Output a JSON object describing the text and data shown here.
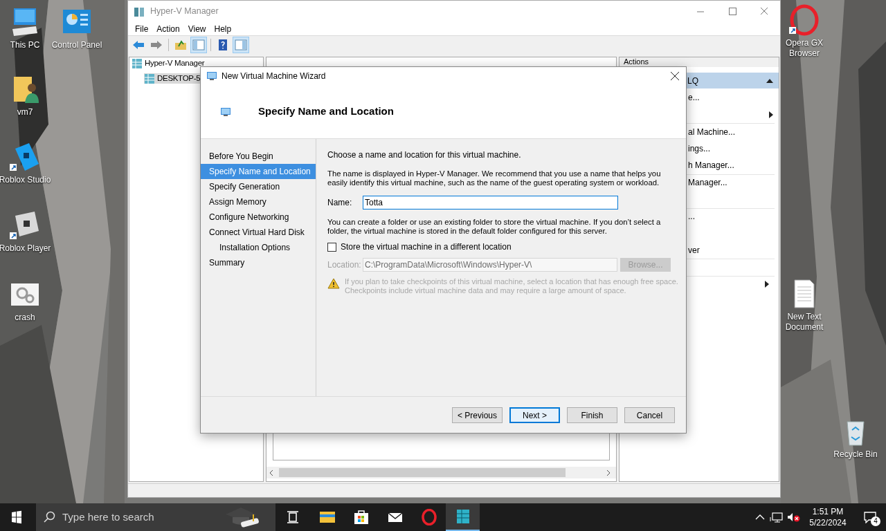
{
  "desktop_icons": [
    {
      "label": "This PC",
      "kind": "pc",
      "shortcut": false
    },
    {
      "label": "Control Panel",
      "kind": "control",
      "shortcut": false
    },
    {
      "label": "vm7",
      "kind": "folder",
      "shortcut": false
    },
    {
      "label": "Roblox Studio",
      "kind": "studio",
      "shortcut": true
    },
    {
      "label": "Roblox Player",
      "kind": "player",
      "shortcut": true
    },
    {
      "label": "crash",
      "kind": "gears",
      "shortcut": false
    },
    {
      "label": "Opera GX Browser",
      "kind": "opera",
      "shortcut": true
    },
    {
      "label": "New Text Document",
      "kind": "text",
      "shortcut": false
    },
    {
      "label": "Recycle Bin",
      "kind": "bin",
      "shortcut": false
    }
  ],
  "window": {
    "title": "Hyper-V Manager",
    "active": false,
    "menu": [
      "File",
      "Action",
      "View",
      "Help"
    ],
    "toolbar": [
      {
        "kind": "back",
        "pressed": false
      },
      {
        "kind": "forward",
        "pressed": false
      },
      {
        "kind": "up",
        "pressed": false
      },
      {
        "kind": "tree",
        "pressed": true
      },
      {
        "kind": "help",
        "pressed": false
      },
      {
        "kind": "actions",
        "pressed": true
      }
    ],
    "tree": [
      {
        "label": "Hyper-V Manager",
        "selected": false,
        "children": [
          {
            "label": "DESKTOP-5",
            "selected": true
          }
        ]
      }
    ],
    "actions": {
      "header": "Actions",
      "group": {
        "label": "LQ",
        "expanded": true
      },
      "items": [
        {
          "kind": "text",
          "label": "e..."
        },
        {
          "kind": "submenu"
        },
        {
          "kind": "text",
          "label": "al Machine..."
        },
        {
          "kind": "text",
          "label": "ings..."
        },
        {
          "kind": "text",
          "label": "h Manager..."
        },
        {
          "kind": "text",
          "label": "Manager..."
        },
        {
          "kind": "text",
          "label": "..."
        },
        {
          "kind": "text",
          "label": "ver"
        },
        {
          "kind": "submenu"
        }
      ]
    }
  },
  "wizard": {
    "title": "New Virtual Machine Wizard",
    "heading": "Specify Name and Location",
    "steps": [
      {
        "label": "Before You Begin",
        "selected": false
      },
      {
        "label": "Specify Name and Location",
        "selected": true
      },
      {
        "label": "Specify Generation",
        "selected": false
      },
      {
        "label": "Assign Memory",
        "selected": false
      },
      {
        "label": "Configure Networking",
        "selected": false
      },
      {
        "label": "Connect Virtual Hard Disk",
        "selected": false,
        "children": [
          {
            "label": "Installation Options",
            "selected": false
          }
        ]
      },
      {
        "label": "Summary",
        "selected": false
      }
    ],
    "intro": "Choose a name and location for this virtual machine.",
    "description": "The name is displayed in Hyper-V Manager. We recommend that you use a name that helps you easily identify this virtual machine, such as the name of the guest operating system or workload.",
    "name_label": "Name:",
    "name_value": "Totta",
    "folder_note": "You can create a folder or use an existing folder to store the virtual machine. If you don’t select a folder, the virtual machine is stored in the default folder configured for this server.",
    "store_checkbox": {
      "label": "Store the virtual machine in a different location",
      "checked": false
    },
    "location": {
      "label": "Location:",
      "value": "C:\\ProgramData\\Microsoft\\Windows\\Hyper-V\\",
      "disabled": true
    },
    "browse": {
      "label": "Browse...",
      "disabled": true
    },
    "warning": {
      "text": "If you plan to take checkpoints of this virtual machine, select a location that has enough free space. Checkpoints include virtual machine data and may require a large amount of space.",
      "disabled": true
    },
    "buttons": [
      {
        "label": "< Previous",
        "default": false
      },
      {
        "label": "Next >",
        "default": true
      },
      {
        "label": "Finish",
        "default": false
      },
      {
        "label": "Cancel",
        "default": false
      }
    ]
  },
  "taskbar": {
    "search_placeholder": "Type here to search",
    "apps": [
      {
        "kind": "taskview",
        "active": false
      },
      {
        "kind": "explorer",
        "active": false
      },
      {
        "kind": "store",
        "active": false
      },
      {
        "kind": "mail",
        "active": false
      },
      {
        "kind": "opera",
        "active": false
      },
      {
        "kind": "hyperv",
        "active": true
      }
    ],
    "time": "1:51 PM",
    "date": "5/22/2024",
    "notifications": "4"
  }
}
